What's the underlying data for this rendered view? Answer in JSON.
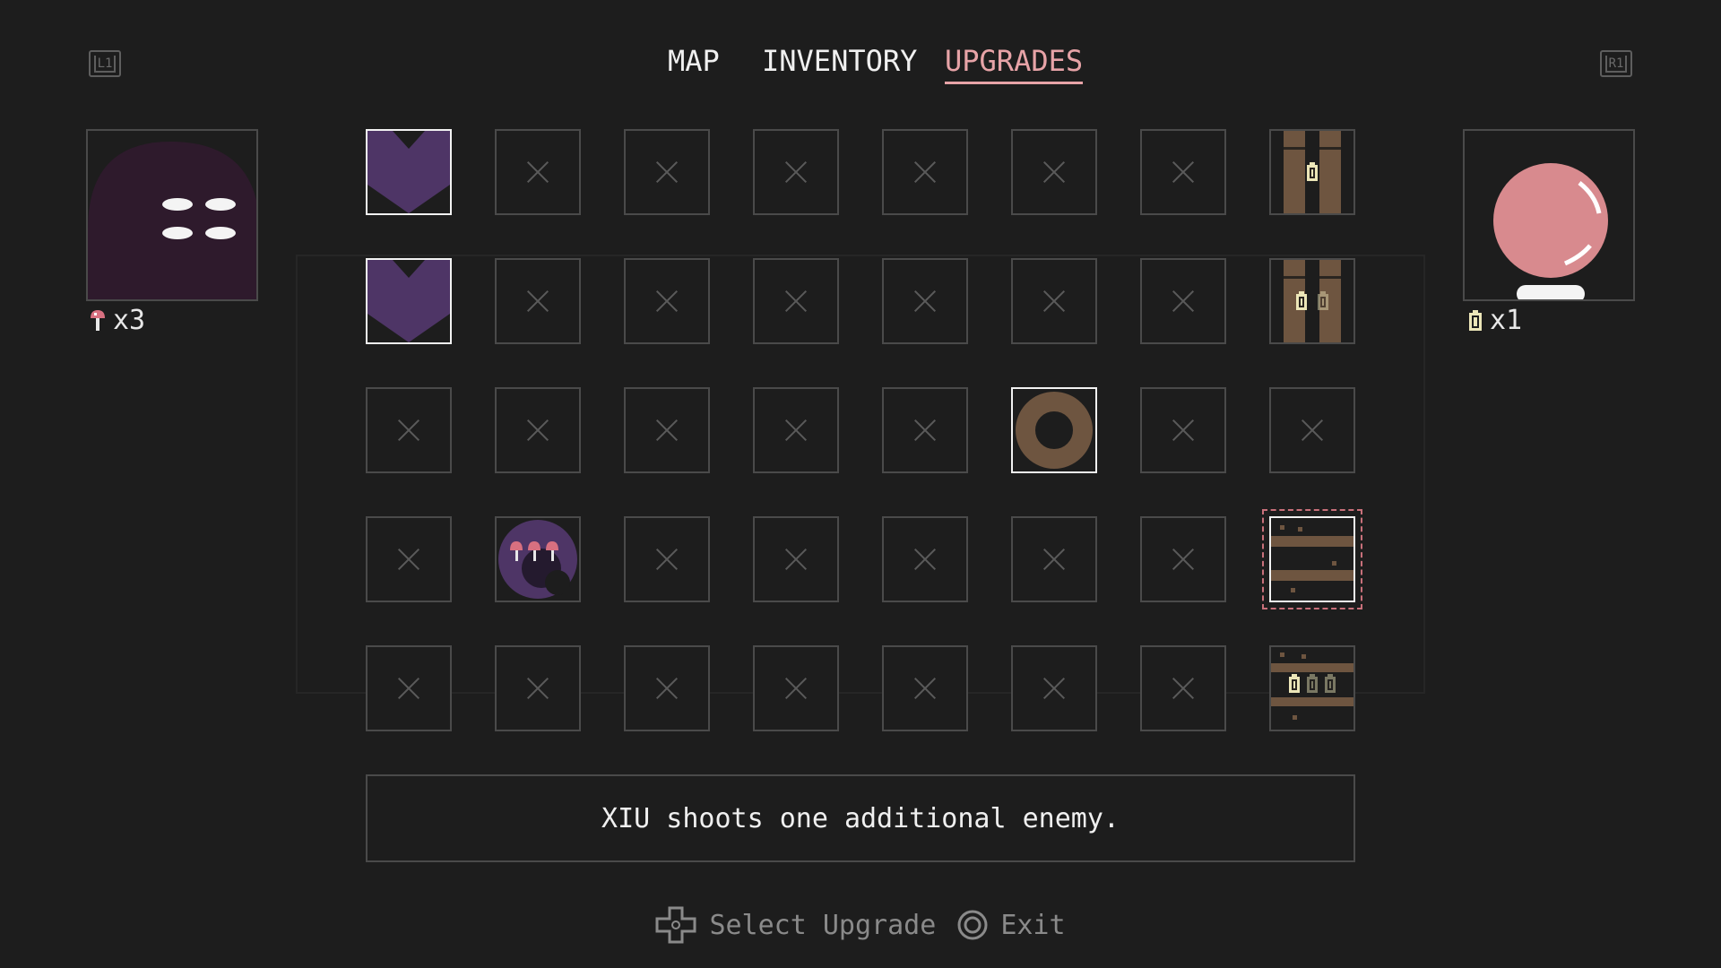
{
  "shoulder": {
    "left": "L1",
    "right": "R1"
  },
  "tabs": [
    {
      "label": "MAP",
      "active": false
    },
    {
      "label": "INVENTORY",
      "active": false
    },
    {
      "label": "UPGRADES",
      "active": true
    }
  ],
  "left_character": {
    "item_icon": "mushroom-icon",
    "count_text": "x3"
  },
  "right_character": {
    "item_icon": "battery-icon",
    "count_text": "x1"
  },
  "grid": {
    "rows": [
      [
        "heart",
        "locked",
        "locked",
        "locked",
        "locked",
        "locked",
        "locked",
        "pillar-battery-1"
      ],
      [
        "heart",
        "locked",
        "locked",
        "locked",
        "locked",
        "locked",
        "locked",
        "pillar-battery-2"
      ],
      [
        "locked",
        "locked",
        "locked",
        "locked",
        "locked",
        "ring",
        "locked",
        "locked"
      ],
      [
        "locked",
        "mushroom-orb",
        "locked",
        "locked",
        "locked",
        "locked",
        "locked",
        "shelf"
      ],
      [
        "locked",
        "locked",
        "locked",
        "locked",
        "locked",
        "locked",
        "locked",
        "shelf-battery-3"
      ]
    ],
    "selected": {
      "row": 3,
      "col": 7
    }
  },
  "description": "XIU shoots one additional enemy.",
  "footer": {
    "select_icon": "dpad-icon",
    "select_label": "Select Upgrade",
    "exit_icon": "circle-button-icon",
    "exit_label": "Exit"
  },
  "colors": {
    "background": "#1d1d1d",
    "accent": "#e7a3a7",
    "heart": "#4e3566",
    "wood": "#6e5540",
    "battery": "#ece6b8"
  }
}
